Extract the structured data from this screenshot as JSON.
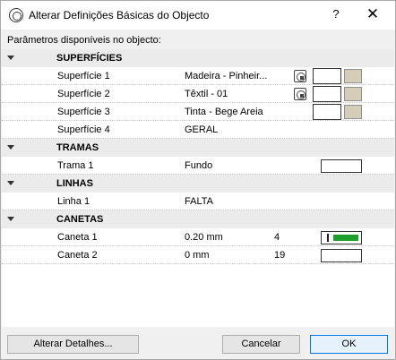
{
  "window": {
    "title": "Alterar Definições Básicas do Objecto",
    "help_label": "?",
    "close_label": "✕"
  },
  "params_label": "Parâmetros disponíveis no objecto:",
  "groups": {
    "surfaces": {
      "label": "SUPERFÍCIES",
      "items": [
        {
          "name": "Superfície 1",
          "value": "Madeira - Pinheir...",
          "color": "#d6cdb8"
        },
        {
          "name": "Superfície 2",
          "value": "Têxtil - 01",
          "color": "#d6cdb8"
        },
        {
          "name": "Superfície 3",
          "value": "Tinta - Bege Areia",
          "color": "#d6cdb8"
        },
        {
          "name": "Superfície 4",
          "value": "GERAL"
        }
      ]
    },
    "hatches": {
      "label": "TRAMAS",
      "items": [
        {
          "name": "Trama 1",
          "value": "Fundo"
        }
      ]
    },
    "lines": {
      "label": "LINHAS",
      "items": [
        {
          "name": "Linha 1",
          "value": "FALTA"
        }
      ]
    },
    "pens": {
      "label": "CANETAS",
      "items": [
        {
          "name": "Caneta 1",
          "value": "0.20 mm",
          "number": "4",
          "color": "#1e9e2a"
        },
        {
          "name": "Caneta 2",
          "value": "0 mm",
          "number": "19"
        }
      ]
    }
  },
  "buttons": {
    "details": "Alterar Detalhes...",
    "cancel": "Cancelar",
    "ok": "OK"
  }
}
